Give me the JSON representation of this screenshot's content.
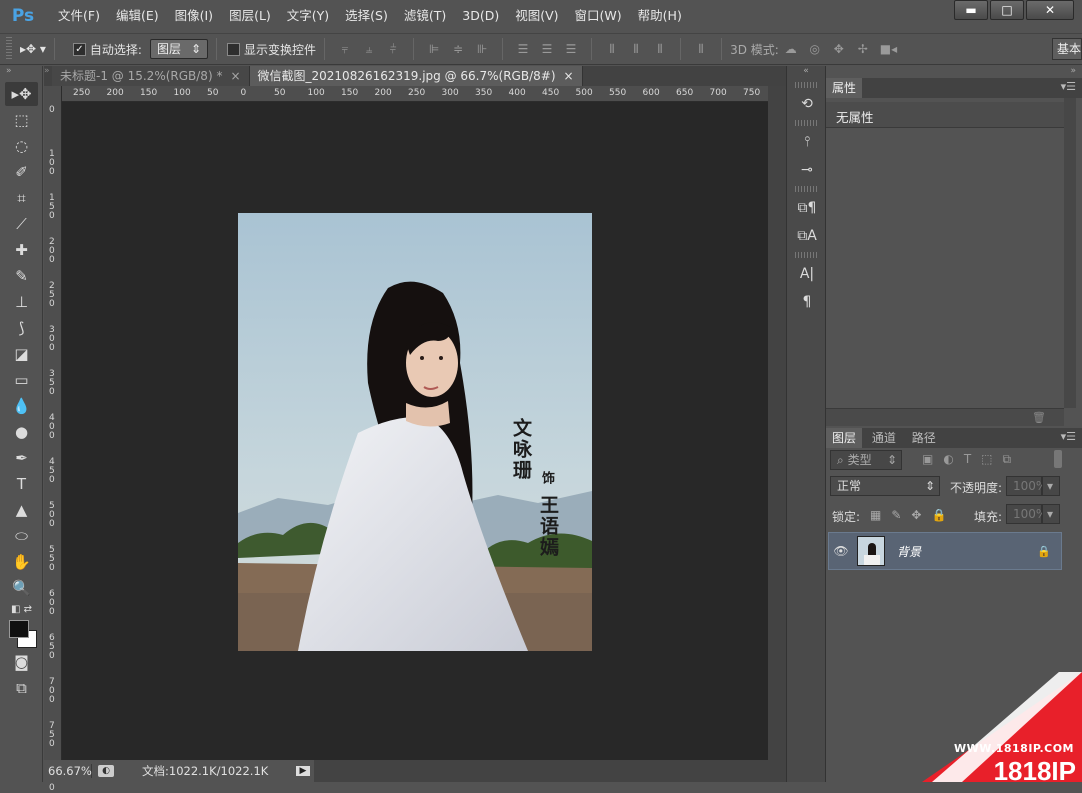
{
  "app": {
    "logo": "Ps"
  },
  "menu": [
    "文件(F)",
    "编辑(E)",
    "图像(I)",
    "图层(L)",
    "文字(Y)",
    "选择(S)",
    "滤镜(T)",
    "3D(D)",
    "视图(V)",
    "窗口(W)",
    "帮助(H)"
  ],
  "window_controls": {
    "minimize": "▬",
    "maximize": "□",
    "close": "✕"
  },
  "options": {
    "auto_select_label": "自动选择:",
    "auto_select_value": "图层",
    "show_transform_label": "显示变换控件",
    "mode_3d_label": "3D 模式:",
    "workspace": "基本"
  },
  "tabs": [
    {
      "label": "未标题-1 @ 15.2%(RGB/8) *",
      "close": "×"
    },
    {
      "label": "微信截图_20210826162319.jpg @ 66.7%(RGB/8#)",
      "close": "×"
    }
  ],
  "ruler_top": [
    "250",
    "200",
    "150",
    "100",
    "50",
    "0",
    "50",
    "100",
    "150",
    "200",
    "250",
    "300",
    "350",
    "400",
    "450",
    "500",
    "550",
    "600",
    "650",
    "700",
    "750"
  ],
  "ruler_left": [
    "0",
    "1 0 0",
    "1 5 0",
    "2 0 0",
    "2 5 0",
    "3 0 0",
    "3 5 0",
    "4 0 0",
    "4 5 0",
    "5 0 0",
    "5 5 0",
    "6 0 0",
    "6 5 0",
    "7 0 0",
    "7 5 0",
    "8 0 0"
  ],
  "photo": {
    "actor": "文咏珊",
    "role_mark": "饰",
    "role": "王语嫣"
  },
  "status": {
    "zoom": "66.67%",
    "doc": "文档:1022.1K/1022.1K"
  },
  "properties": {
    "tab": "属性",
    "empty": "无属性"
  },
  "layers": {
    "tabs": [
      "图层",
      "通道",
      "路径"
    ],
    "filter_label": "类型",
    "blend_mode": "正常",
    "opacity_label": "不透明度:",
    "opacity_value": "100%",
    "lock_label": "锁定:",
    "fill_label": "填充:",
    "fill_value": "100%",
    "items": [
      {
        "name": "背景"
      }
    ]
  },
  "watermark": {
    "url": "WWW.1818IP.COM",
    "brand": "1818IP"
  }
}
